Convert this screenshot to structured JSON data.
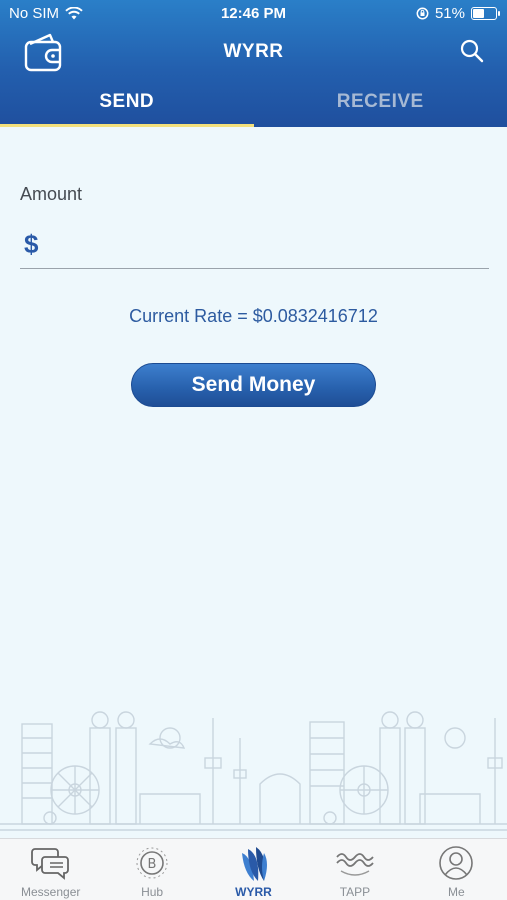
{
  "status_bar": {
    "carrier": "No SIM",
    "time": "12:46 PM",
    "battery_percent": "51%",
    "battery_level": 0.51
  },
  "header": {
    "title": "WYRR",
    "left_icon": "wallet-icon",
    "right_icon": "search-icon"
  },
  "tabs": [
    {
      "label": "SEND",
      "active": true
    },
    {
      "label": "RECEIVE",
      "active": false
    }
  ],
  "form": {
    "amount_label": "Amount",
    "currency_symbol": "$",
    "amount_value": "",
    "rate_text": "Current Rate = $0.0832416712",
    "send_button_label": "Send Money"
  },
  "bottom_nav": [
    {
      "label": "Messenger",
      "icon": "messenger-icon",
      "active": false
    },
    {
      "label": "Hub",
      "icon": "bitcoin-hub-icon",
      "active": false
    },
    {
      "label": "WYRR",
      "icon": "wyrr-logo-icon",
      "active": true
    },
    {
      "label": "TAPP",
      "icon": "tapp-wave-icon",
      "active": false
    },
    {
      "label": "Me",
      "icon": "profile-icon",
      "active": false
    }
  ],
  "colors": {
    "header_blue": "#235fae",
    "accent_yellow": "#f3e07c",
    "active_blue": "#2a5aa8",
    "background": "#eef8fc"
  }
}
